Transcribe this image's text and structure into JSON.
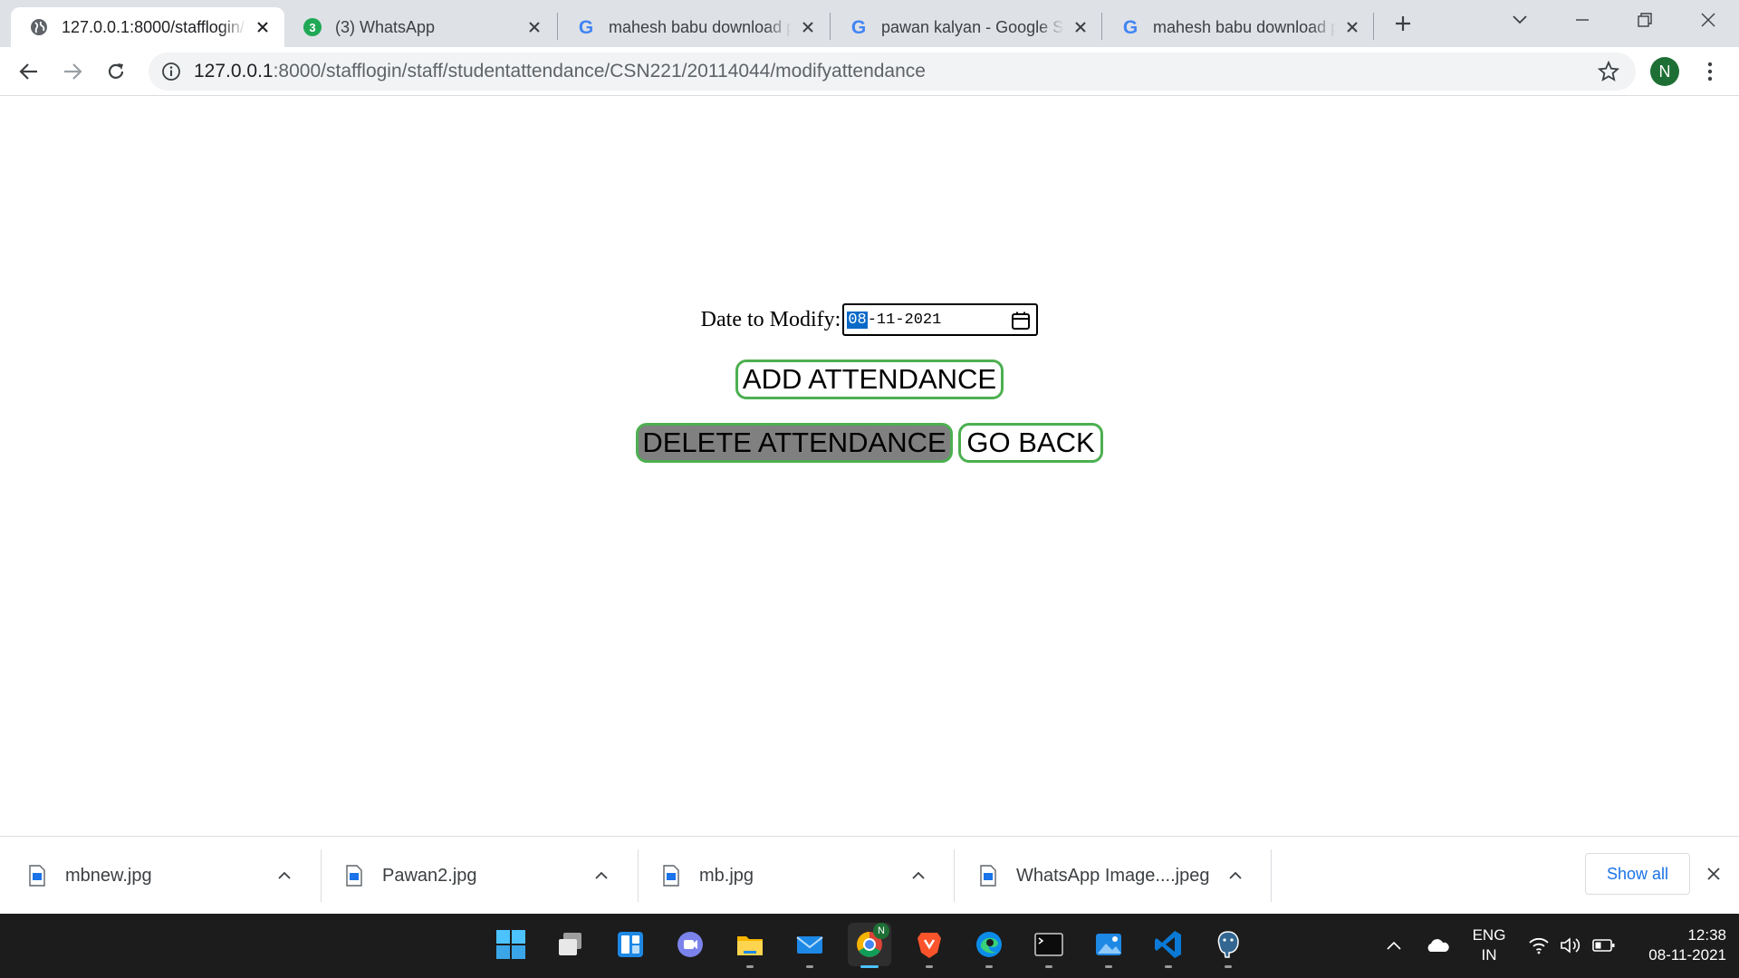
{
  "browser": {
    "tabs": [
      {
        "title": "127.0.0.1:8000/stafflogin/",
        "favicon": "globe-icon",
        "active": true
      },
      {
        "title": "(3) WhatsApp",
        "favicon": "whatsapp-icon",
        "badge": "3",
        "active": false
      },
      {
        "title": "mahesh babu download p",
        "favicon": "google-icon",
        "active": false
      },
      {
        "title": "pawan kalyan - Google Se",
        "favicon": "google-icon",
        "active": false
      },
      {
        "title": "mahesh babu download p",
        "favicon": "google-icon",
        "active": false
      }
    ],
    "google_letter": "G",
    "url_host": "127.0.0.1",
    "url_path": ":8000/stafflogin/staff/studentattendance/CSN221/20114044/modifyattendance",
    "profile_initial": "N",
    "colors": {
      "tab_strip": "#dee1e6",
      "omnibox": "#f1f3f4",
      "profile": "#1e6f35"
    }
  },
  "page": {
    "date_label": "Date to Modify:",
    "date_value": {
      "day": "08",
      "rest": "-11-2021"
    },
    "add_button": "ADD ATTENDANCE",
    "delete_button": "DELETE ATTENDANCE",
    "back_button": "GO BACK",
    "colors": {
      "button_border": "#4caf50",
      "delete_bg": "#808080",
      "date_selected": "#0a6ac8"
    }
  },
  "downloads": {
    "items": [
      {
        "name": "mbnew.jpg"
      },
      {
        "name": "Pawan2.jpg"
      },
      {
        "name": "mb.jpg"
      },
      {
        "name": "WhatsApp Image....jpeg"
      }
    ],
    "show_all": "Show all"
  },
  "taskbar": {
    "apps": [
      "start-icon",
      "task-view-icon",
      "widgets-icon",
      "teams-chat-icon",
      "file-explorer-icon",
      "mail-icon",
      "chrome-icon",
      "brave-icon",
      "edge-icon",
      "terminal-icon",
      "photos-icon",
      "vscode-icon",
      "postgresql-icon"
    ],
    "chrome_profile_badge": "N",
    "language": "ENG",
    "region": "IN",
    "time": "12:38",
    "date": "08-11-2021"
  }
}
